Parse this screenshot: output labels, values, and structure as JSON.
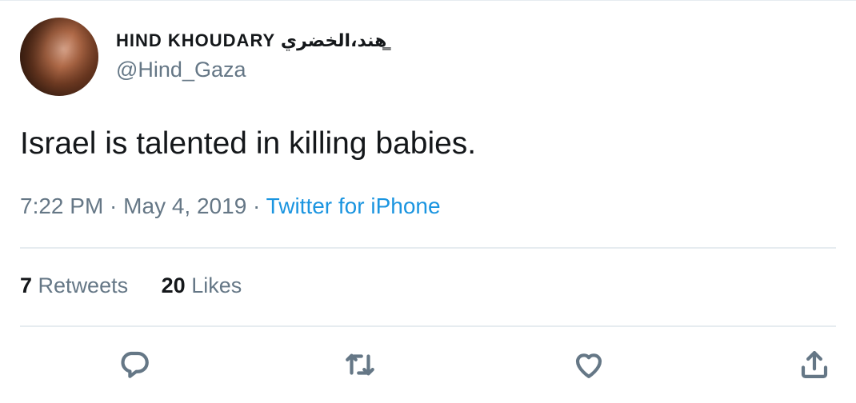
{
  "user": {
    "display_name": "HIND KHOUDARY هند،الخضري ͇",
    "handle": "@Hind_Gaza"
  },
  "tweet": {
    "text": "Israel is talented in killing babies.",
    "time": "7:22 PM",
    "separator1": " · ",
    "date": "May 4, 2019",
    "separator2": " · ",
    "source": "Twitter for iPhone"
  },
  "stats": {
    "retweets_count": "7",
    "retweets_label": "Retweets",
    "likes_count": "20",
    "likes_label": "Likes"
  },
  "actions": {
    "reply_icon": "reply-icon",
    "retweet_icon": "retweet-icon",
    "like_icon": "heart-icon",
    "share_icon": "share-icon"
  },
  "colors": {
    "text": "#14171a",
    "secondary": "#657786",
    "link": "#1b95e0",
    "divider": "#e6ecf0"
  }
}
